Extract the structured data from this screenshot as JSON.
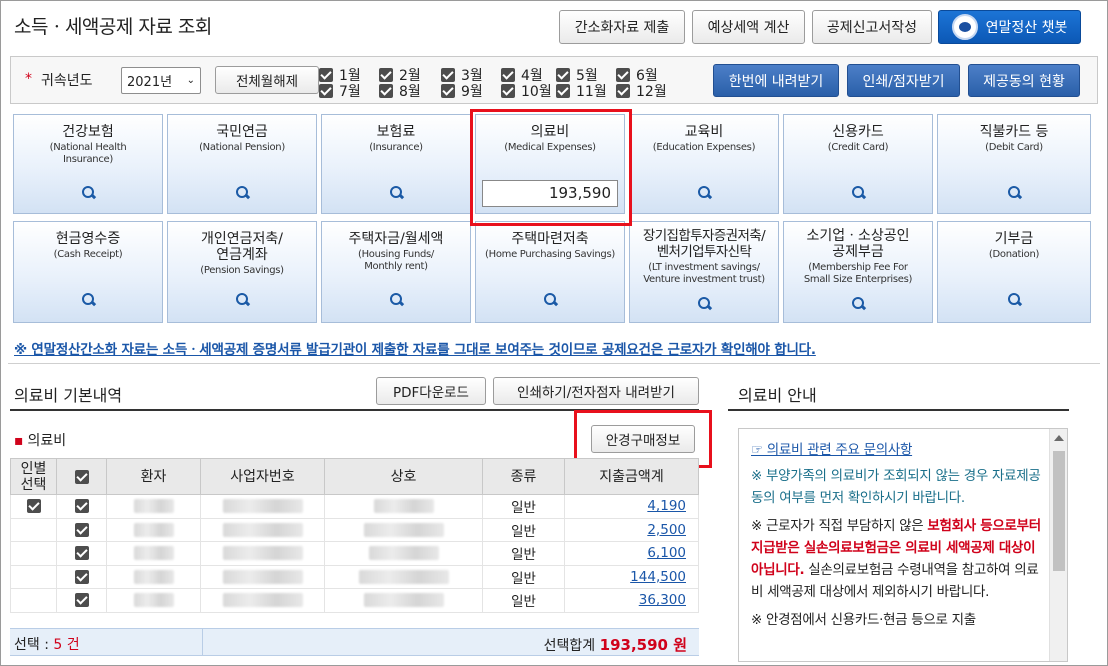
{
  "header": {
    "title": "소득ㆍ세액공제 자료 조회",
    "buttons": [
      "간소화자료 제출",
      "예상세액 계산",
      "공제신고서작성"
    ],
    "chatbot": "연말정산 챗봇"
  },
  "filter": {
    "year_label": "귀속년도",
    "year_value": "2021년",
    "clear_all": "전체월해제",
    "months": [
      "1월",
      "2월",
      "3월",
      "4월",
      "5월",
      "6월",
      "7월",
      "8월",
      "9월",
      "10월",
      "11월",
      "12월"
    ],
    "actions": [
      "한번에 내려받기",
      "인쇄/점자받기",
      "제공동의 현황"
    ]
  },
  "categories": [
    {
      "ko": "건강보험",
      "en": "(National Health\nInsurance)"
    },
    {
      "ko": "국민연금",
      "en": "(National Pension)"
    },
    {
      "ko": "보험료",
      "en": "(Insurance)"
    },
    {
      "ko": "의료비",
      "en": "(Medical Expenses)",
      "amount": "193,590"
    },
    {
      "ko": "교육비",
      "en": "(Education Expenses)"
    },
    {
      "ko": "신용카드",
      "en": "(Credit Card)"
    },
    {
      "ko": "직불카드 등",
      "en": "(Debit Card)"
    },
    {
      "ko": "현금영수증",
      "en": "(Cash Receipt)"
    },
    {
      "ko": "개인연금저축/\n연금계좌",
      "en": "(Pension Savings)"
    },
    {
      "ko": "주택자금/월세액",
      "en": "(Housing Funds/\nMonthly rent)"
    },
    {
      "ko": "주택마련저축",
      "en": "(Home Purchasing Savings)"
    },
    {
      "ko": "장기집합투자증권저축/\n벤처기업투자신탁",
      "en": "(LT investment savings/\nVenture investment trust)"
    },
    {
      "ko": "소기업ㆍ소상공인\n공제부금",
      "en": "(Membership Fee For\nSmall Size Enterprises)"
    },
    {
      "ko": "기부금",
      "en": "(Donation)"
    }
  ],
  "notice": "※ 연말정산간소화 자료는 소득ㆍ세액공제 증명서류 발급기관이 제출한 자료를 그대로 보여주는 것이므로 공제요건은 근로자가 확인해야 합니다.",
  "medical": {
    "title": "의료비 기본내역",
    "pdf_button": "PDF다운로드",
    "print_button": "인쇄하기/전자점자 내려받기",
    "sub_title": "의료비",
    "glasses_button": "안경구매정보",
    "columns": [
      "인별\n선택",
      "",
      "환자",
      "사업자번호",
      "상호",
      "종류",
      "지출금액계"
    ],
    "rows": [
      {
        "type": "일반",
        "amount": "4,190"
      },
      {
        "type": "일반",
        "amount": "2,500"
      },
      {
        "type": "일반",
        "amount": "6,100"
      },
      {
        "type": "일반",
        "amount": "144,500"
      },
      {
        "type": "일반",
        "amount": "36,300"
      }
    ],
    "footer_left_label": "선택 : ",
    "footer_left_value": "5 건",
    "footer_right_label": "선택합계 ",
    "footer_right_value": "193,590 원"
  },
  "guide": {
    "title": "의료비 안내",
    "link": "☞ 의료비 관련 주요 문의사항",
    "p1": "※ 부양가족의 의료비가 조회되지 않는 경우 자료제공동의 여부를 먼저 확인하시기 바랍니다.",
    "p2_a": "※ 근로자가 직접 부담하지 않은 ",
    "p2_b": "보험회사 등으로부터 지급받은 실손의료보험금은 의료비 세액공제 대상이 아닙니다.",
    "p2_c": " 실손의료보험금 수령내역을 참고하여 의료비 세액공제 대상에서 제외하시기 바랍니다.",
    "p3": "※ 안경점에서 신용카드·현금 등으로 지출"
  }
}
